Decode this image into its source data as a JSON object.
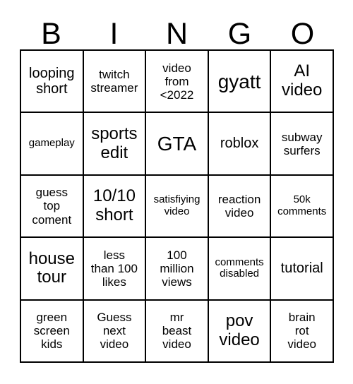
{
  "header": {
    "letters": [
      "B",
      "I",
      "N",
      "G",
      "O"
    ]
  },
  "grid": {
    "rows": 5,
    "columns": 5,
    "cells": [
      {
        "text": "looping\nshort",
        "size": "lg"
      },
      {
        "text": "twitch\nstreamer",
        "size": "md"
      },
      {
        "text": "video\nfrom\n<2022",
        "size": "md"
      },
      {
        "text": "gyatt",
        "size": "xxl"
      },
      {
        "text": "AI\nvideo",
        "size": "xl"
      },
      {
        "text": "gameplay",
        "size": "sm"
      },
      {
        "text": "sports\nedit",
        "size": "xl"
      },
      {
        "text": "GTA",
        "size": "xxl"
      },
      {
        "text": "roblox",
        "size": "lg"
      },
      {
        "text": "subway\nsurfers",
        "size": "md"
      },
      {
        "text": "guess\ntop\ncoment",
        "size": "md"
      },
      {
        "text": "10/10\nshort",
        "size": "xl"
      },
      {
        "text": "satisfiying\nvideo",
        "size": "sm"
      },
      {
        "text": "reaction\nvideo",
        "size": "md"
      },
      {
        "text": "50k\ncomments",
        "size": "sm"
      },
      {
        "text": "house\ntour",
        "size": "xl"
      },
      {
        "text": "less\nthan 100\nlikes",
        "size": "md"
      },
      {
        "text": "100\nmillion\nviews",
        "size": "md"
      },
      {
        "text": "comments\ndisabled",
        "size": "sm"
      },
      {
        "text": "tutorial",
        "size": "lg"
      },
      {
        "text": "green\nscreen\nkids",
        "size": "md"
      },
      {
        "text": "Guess\nnext\nvideo",
        "size": "md"
      },
      {
        "text": "mr\nbeast\nvideo",
        "size": "md"
      },
      {
        "text": "pov\nvideo",
        "size": "xl"
      },
      {
        "text": "brain\nrot\nvideo",
        "size": "md"
      }
    ]
  },
  "colors": {
    "background": "#ffffff",
    "text": "#000000",
    "grid_line": "#000000"
  }
}
